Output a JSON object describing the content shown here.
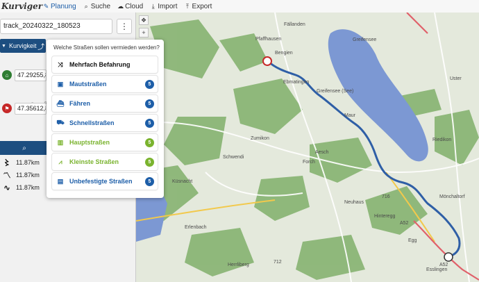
{
  "app": {
    "logo_text": "Kurviger"
  },
  "menu": {
    "items": [
      {
        "label": "Planung",
        "icon": "pencil-icon",
        "active": true
      },
      {
        "label": "Suche",
        "icon": "search-icon",
        "active": false
      },
      {
        "label": "Cloud",
        "icon": "cloud-icon",
        "active": false
      },
      {
        "label": "Import",
        "icon": "import-icon",
        "active": false
      },
      {
        "label": "Export",
        "icon": "export-icon",
        "active": false
      }
    ]
  },
  "sidebar": {
    "track_name": "track_20240322_180523",
    "route_mode_label": "Kurvigkeit",
    "waypoints": [
      {
        "icon": "home-icon",
        "coords": "47.29255,8.7"
      },
      {
        "icon": "flag-icon",
        "coords": "47.35612,8.6"
      }
    ],
    "distances": [
      {
        "icon": "curvy-road-icon",
        "value": "11.87km"
      },
      {
        "icon": "curvy-road-icon",
        "value": "11.87km"
      },
      {
        "icon": "very-curvy-road-icon",
        "value": "11.87km"
      }
    ]
  },
  "avoid_popup": {
    "title": "Welche Straßen sollen vermieden werden?",
    "options": [
      {
        "label": "Mehrfach Befahrung",
        "icon": "shuffle-icon",
        "style": "dark",
        "badge": ""
      },
      {
        "label": "Mautstraßen",
        "icon": "toll-icon",
        "style": "blue",
        "badge": "5"
      },
      {
        "label": "Fähren",
        "icon": "ferry-icon",
        "style": "blue",
        "badge": "5"
      },
      {
        "label": "Schnellstraßen",
        "icon": "car-icon",
        "style": "blue",
        "badge": "5"
      },
      {
        "label": "Hauptstraßen",
        "icon": "main-road-icon",
        "style": "green",
        "badge": "5"
      },
      {
        "label": "Kleinste Straßen",
        "icon": "small-road-icon",
        "style": "green",
        "badge": "5"
      },
      {
        "label": "Unbefestigte Straßen",
        "icon": "unpaved-road-icon",
        "style": "blue",
        "badge": "5"
      }
    ],
    "colors": {
      "blue": "#1d5ea8",
      "green": "#7ab32e",
      "badge_blue": "#1d5ea8",
      "badge_green": "#7ab32e"
    }
  },
  "map": {
    "labels": [
      "Pfaffhausen",
      "Fällanden",
      "Greifensee",
      "Bengien",
      "Ebmatingen",
      "Maur",
      "Uster",
      "Zumikon",
      "Aesch",
      "Forch",
      "Riedikon",
      "Mönchaltorf",
      "Küsnacht",
      "Erlenbach",
      "Hinteregg",
      "Egg",
      "Esslingen",
      "Herrliberg",
      "Greifensee (See)",
      "Neuhaus",
      "Schwendi"
    ],
    "road_labels": [
      "716",
      "A52",
      "712",
      "A52"
    ],
    "colors": {
      "water": "#7c98d3",
      "forest": "#7eaa6a",
      "route": "#2f5fa6"
    }
  }
}
